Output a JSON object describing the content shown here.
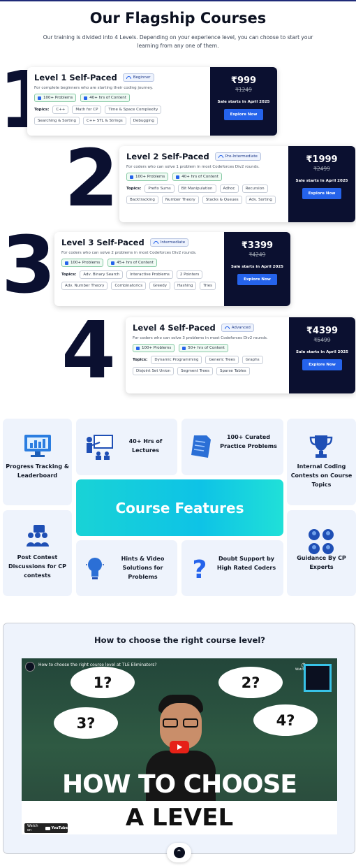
{
  "header": {
    "title": "Our Flagship Courses",
    "subtitle": "Our training is divided into 4 Levels. Depending on your experience level, you can choose to start your learning from any one of them."
  },
  "levels": [
    {
      "num": "1",
      "title": "Level 1 Self-Paced",
      "badge": "Beginner",
      "desc": "For complete beginners who are starting their coding journey.",
      "chip1": "100+ Problems",
      "chip2": "40+ hrs of Content",
      "topics_label": "Topics:",
      "topics": [
        "C++",
        "Math for CP",
        "Time & Space Complexity",
        "Searching & Sorting",
        "C++ STL & Strings",
        "Debugging"
      ],
      "price": "₹999",
      "old": "₹1249",
      "sale": "Sale starts in April 2025",
      "cta": "Explore Now"
    },
    {
      "num": "2",
      "title": "Level 2 Self-Paced",
      "badge": "Pre-Intermediate",
      "desc": "For coders who can solve 1 problem in most Codeforces Div2 rounds.",
      "chip1": "100+ Problems",
      "chip2": "40+ hrs of Content",
      "topics_label": "Topics:",
      "topics": [
        "Prefix Sums",
        "Bit Manipulation",
        "Adhoc",
        "Recursion",
        "Backtracking",
        "Number Theory",
        "Stacks & Queues",
        "Adv. Sorting"
      ],
      "price": "₹1999",
      "old": "₹2499",
      "sale": "Sale starts in April 2025",
      "cta": "Explore Now"
    },
    {
      "num": "3",
      "title": "Level 3 Self-Paced",
      "badge": "Intermediate",
      "desc": "For coders who can solve 2 problems in most Codeforces Div2 rounds.",
      "chip1": "100+ Problems",
      "chip2": "45+ hrs of Content",
      "topics_label": "Topics:",
      "topics": [
        "Adv. Binary Search",
        "Interactive Problems",
        "2 Pointers",
        "Adv. Number Theory",
        "Combinatorics",
        "Greedy",
        "Hashing",
        "Tries"
      ],
      "price": "₹3399",
      "old": "₹4249",
      "sale": "Sale starts in April 2025",
      "cta": "Explore Now"
    },
    {
      "num": "4",
      "title": "Level 4 Self-Paced",
      "badge": "Advanced",
      "desc": "For coders who can solve 3 problems in most Codeforces Div2 rounds.",
      "chip1": "100+ Problems",
      "chip2": "50+ hrs of Content",
      "topics_label": "Topics:",
      "topics": [
        "Dynamic Programming",
        "Generic Trees",
        "Graphs",
        "Disjoint Set Union",
        "Segment Trees",
        "Sparse Tables"
      ],
      "price": "₹4399",
      "old": "₹5499",
      "sale": "Sale starts in April 2025",
      "cta": "Explore Now"
    }
  ],
  "features": {
    "heading": "Course Features",
    "progress": "Progress Tracking & Leaderboard",
    "lectures": "40+ Hrs of Lectures",
    "practice": "100+ Curated Practice Problems",
    "contests": "Internal Coding Contests on Course Topics",
    "discussions": "Post Contest Discussions for CP contests",
    "hints": "Hints & Video Solutions for Problems",
    "doubt": "Doubt Support by High Rated Coders",
    "guidance": "Guidance By CP Experts"
  },
  "video": {
    "heading": "How to choose the right course level?",
    "yt_title": "How to choose the right course level at TLE Eliminators?",
    "watch_later": "Watch later",
    "share": "Share",
    "q1": "1?",
    "q2": "2?",
    "q3": "3?",
    "q4": "4?",
    "line1": "HOW TO CHOOSE",
    "line2": "A LEVEL",
    "watch_on": "Watch on",
    "youtube": "YouTube"
  }
}
